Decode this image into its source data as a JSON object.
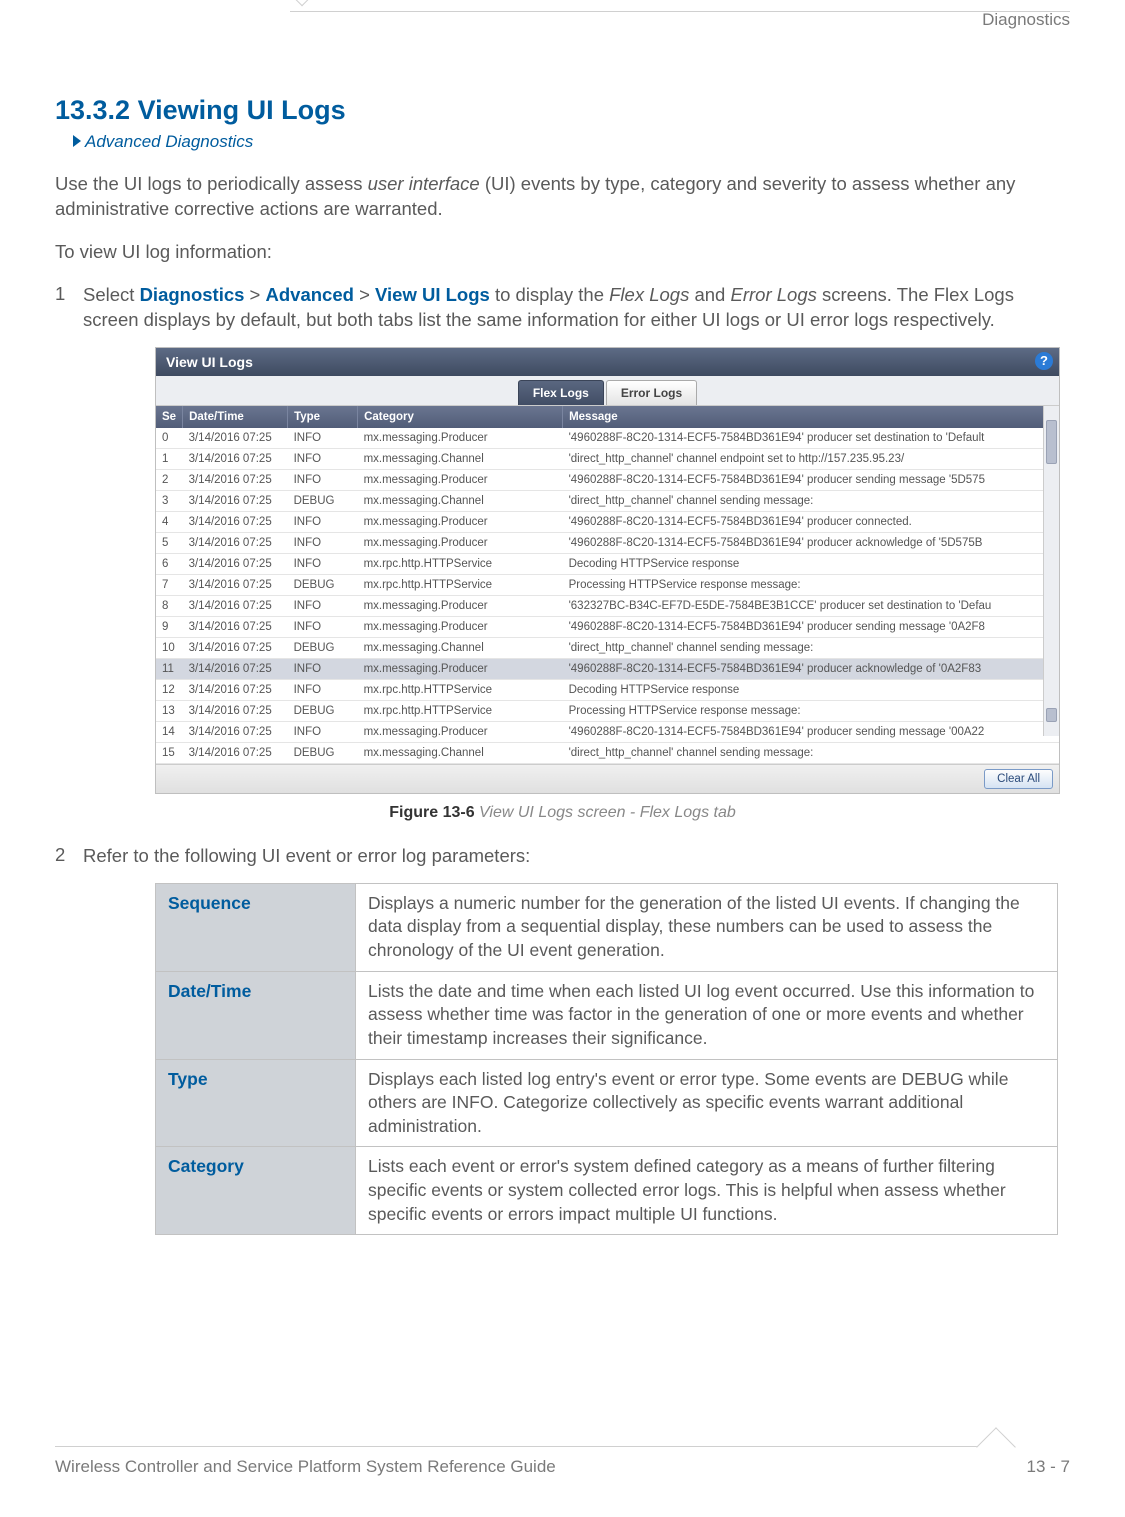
{
  "header": {
    "category": "Diagnostics"
  },
  "section": {
    "title": "13.3.2 Viewing UI Logs",
    "breadcrumb": "Advanced Diagnostics"
  },
  "para1_a": "Use the UI logs to periodically assess ",
  "para1_i": "user interface",
  "para1_b": " (UI) events by type, category and severity to assess whether any administrative corrective actions are warranted.",
  "para2": "To view UI log information:",
  "step1": {
    "num": "1",
    "a": "Select ",
    "d": "Diagnostics",
    "s1": " > ",
    "adv": "Advanced",
    "s2": " > ",
    "v": "View UI Logs",
    "b": " to display the ",
    "fl": "Flex Logs",
    "c": " and ",
    "el": "Error Logs",
    "d2": " screens. The Flex Logs screen displays by default, but both tabs list the same information for either UI logs or UI error logs respectively."
  },
  "ss": {
    "title": "View UI Logs",
    "help": "?",
    "tabs": {
      "flex": "Flex Logs",
      "error": "Error Logs"
    },
    "cols": {
      "se": "Se",
      "dt": "Date/Time",
      "ty": "Type",
      "cat": "Category",
      "msg": "Message"
    },
    "rows": [
      {
        "se": "0",
        "dt": "3/14/2016 07:25",
        "ty": "INFO",
        "cat": "mx.messaging.Producer",
        "msg": "'4960288F-8C20-1314-ECF5-7584BD361E94' producer set destination to 'Default"
      },
      {
        "se": "1",
        "dt": "3/14/2016 07:25",
        "ty": "INFO",
        "cat": "mx.messaging.Channel",
        "msg": "'direct_http_channel' channel endpoint set to http://157.235.95.23/"
      },
      {
        "se": "2",
        "dt": "3/14/2016 07:25",
        "ty": "INFO",
        "cat": "mx.messaging.Producer",
        "msg": "'4960288F-8C20-1314-ECF5-7584BD361E94' producer sending message '5D575"
      },
      {
        "se": "3",
        "dt": "3/14/2016 07:25",
        "ty": "DEBUG",
        "cat": "mx.messaging.Channel",
        "msg": "'direct_http_channel' channel sending message:"
      },
      {
        "se": "4",
        "dt": "3/14/2016 07:25",
        "ty": "INFO",
        "cat": "mx.messaging.Producer",
        "msg": "'4960288F-8C20-1314-ECF5-7584BD361E94' producer connected."
      },
      {
        "se": "5",
        "dt": "3/14/2016 07:25",
        "ty": "INFO",
        "cat": "mx.messaging.Producer",
        "msg": "'4960288F-8C20-1314-ECF5-7584BD361E94' producer acknowledge of '5D575B"
      },
      {
        "se": "6",
        "dt": "3/14/2016 07:25",
        "ty": "INFO",
        "cat": "mx.rpc.http.HTTPService",
        "msg": "Decoding HTTPService response"
      },
      {
        "se": "7",
        "dt": "3/14/2016 07:25",
        "ty": "DEBUG",
        "cat": "mx.rpc.http.HTTPService",
        "msg": "Processing HTTPService response message:"
      },
      {
        "se": "8",
        "dt": "3/14/2016 07:25",
        "ty": "INFO",
        "cat": "mx.messaging.Producer",
        "msg": "'632327BC-B34C-EF7D-E5DE-7584BE3B1CCE' producer set destination to 'Defau"
      },
      {
        "se": "9",
        "dt": "3/14/2016 07:25",
        "ty": "INFO",
        "cat": "mx.messaging.Producer",
        "msg": "'4960288F-8C20-1314-ECF5-7584BD361E94' producer sending message '0A2F8"
      },
      {
        "se": "10",
        "dt": "3/14/2016 07:25",
        "ty": "DEBUG",
        "cat": "mx.messaging.Channel",
        "msg": "'direct_http_channel' channel sending message:"
      },
      {
        "se": "11",
        "dt": "3/14/2016 07:25",
        "ty": "INFO",
        "cat": "mx.messaging.Producer",
        "msg": "'4960288F-8C20-1314-ECF5-7584BD361E94' producer acknowledge of '0A2F83",
        "hl": true
      },
      {
        "se": "12",
        "dt": "3/14/2016 07:25",
        "ty": "INFO",
        "cat": "mx.rpc.http.HTTPService",
        "msg": "Decoding HTTPService response"
      },
      {
        "se": "13",
        "dt": "3/14/2016 07:25",
        "ty": "DEBUG",
        "cat": "mx.rpc.http.HTTPService",
        "msg": "Processing HTTPService response message:"
      },
      {
        "se": "14",
        "dt": "3/14/2016 07:25",
        "ty": "INFO",
        "cat": "mx.messaging.Producer",
        "msg": "'4960288F-8C20-1314-ECF5-7584BD361E94' producer sending message '00A22"
      },
      {
        "se": "15",
        "dt": "3/14/2016 07:25",
        "ty": "DEBUG",
        "cat": "mx.messaging.Channel",
        "msg": "'direct_http_channel' channel sending message:"
      }
    ],
    "clear": "Clear All"
  },
  "figure": {
    "bold": "Figure 13-6",
    "italic": "  View UI Logs screen - Flex Logs tab"
  },
  "step2": {
    "num": "2",
    "txt": "Refer to the following UI event or error log parameters:"
  },
  "params": [
    {
      "k": "Sequence",
      "v": "Displays a numeric number for the generation of the listed UI events. If changing the data display from a sequential display, these numbers can be used to assess the chronology of the UI event generation."
    },
    {
      "k": "Date/Time",
      "v": "Lists the date and time when each listed UI log event occurred. Use this information to assess whether time was factor in the generation of one or more events and whether their timestamp increases their significance."
    },
    {
      "k": "Type",
      "v": "Displays each listed log entry's event or error type. Some events are DEBUG while others are INFO. Categorize collectively as specific events warrant additional administration."
    },
    {
      "k": "Category",
      "v": "Lists each event or error's system defined category as a means of further filtering specific events or system collected error logs. This is helpful when assess whether specific events or errors impact multiple UI functions."
    }
  ],
  "footer": {
    "guide": "Wireless Controller and Service Platform System Reference Guide",
    "page": "13 - 7"
  }
}
